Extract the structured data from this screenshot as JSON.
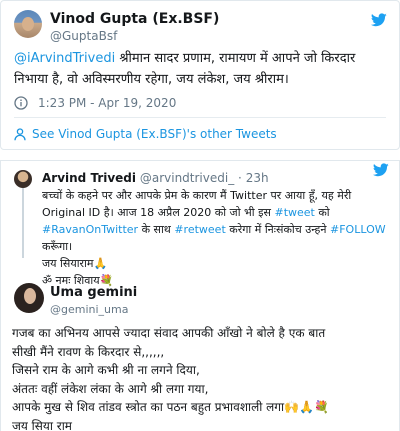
{
  "tweet1": {
    "author_name": "Vinod Gupta (Ex.BSF)",
    "author_handle": "@GuptaBsf",
    "mention": "@iArvindTrivedi",
    "text": " श्रीमान सादर प्रणाम, रामायण में आपने जो किरदार निभाया है, वो अविस्मरणीय रहेगा, जय लंकेश, जय श्रीराम।",
    "timestamp": "1:23 PM - Apr 19, 2020",
    "see_more_label": "See Vinod Gupta (Ex.BSF)'s other Tweets"
  },
  "quoted_tweet": {
    "author_name": "Arvind Trivedi",
    "author_handle": "@arvindtrivedi_",
    "time_ago": "23h",
    "line1": "बच्चों के कहने पर और आपके प्रेम के कारण मैं Twitter पर आया हूँ, यह मेरी",
    "line2a": "Original ID है। आज 18 अप्रैल 2020 को जो भी इस ",
    "hashtag_tweet": "#tweet",
    "line2b": " को",
    "hashtag_ravan": "#RavanOnTwitter",
    "line3a": " के साथ ",
    "hashtag_retweet": "#retweet",
    "line3b": " करेगा में निःसंकोच उन्हने ",
    "hashtag_follow": "#FOLLOW",
    "line4": " करूँगा।",
    "line5": "जय सियाराम🙏",
    "line6": "ॐ नमः शिवाय💐"
  },
  "reply": {
    "author_name": "Uma gemini",
    "author_handle": "@gemini_uma",
    "line1": "गजब का अभिनय आपसे ज्यादा संवाद आपकी आँखो ने बोले है एक बात",
    "line2": "सीखी मैंने रावण के किरदार से,,,,,,",
    "line3": "जिसने राम के आगे कभी श्री ना लगने दिया,",
    "line4": "अंततः वहीं लंकेश लंका के आगे श्री लगा गया,",
    "line5": "आपके मुख से शिव तांडव स्त्रोत का पठन बहुत प्रभावशाली लगा🙌🙏💐",
    "line6": "जय सिया राम"
  },
  "colors": {
    "link": "#1b95e0",
    "muted": "#657786",
    "text": "#14171a"
  },
  "icons": {
    "brand": "twitter-bird-icon",
    "info": "info-icon",
    "profile": "person-icon"
  }
}
